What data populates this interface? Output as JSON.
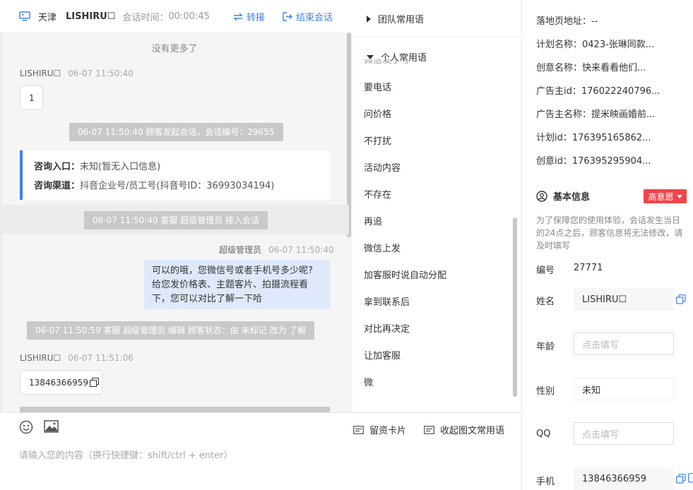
{
  "header": {
    "city": "天津",
    "username": "LISHIRU☐",
    "session_time_label": "会话时间：",
    "session_time": "00:00:45",
    "transfer_label": "转接",
    "end_label": "结束会话"
  },
  "chat": {
    "no_more": "没有更多了",
    "msg1": {
      "sender": "LISHIRU☐",
      "time": "06-07 11:50:40",
      "text": "1"
    },
    "sys1": "06-07 11:50:40 顾客发起会话，会话编号：29655",
    "consult": {
      "entry_label": "咨询入口：",
      "entry_value": "未知(暂无入口信息)",
      "channel_label": "咨询渠道：",
      "channel_value": "抖音企业号/员工号(抖音号ID：36993034194)"
    },
    "sys2": "06-07 11:50:40 客服 超级管理员 接入会话",
    "msg2": {
      "sender": "超级管理员",
      "time": "06-07 11:50:40",
      "lines": [
        "可以的哦，您微信号或者手机号多少呢?",
        "给您发价格表、主题客片、拍摄流程看",
        "下，您可以对比了解一下哈"
      ]
    },
    "sys3": "06-07 11:50:59 客服 超级管理员 编辑 顾客状态：由 未标记 改为 了解",
    "msg3": {
      "sender": "LISHIRU☐",
      "time": "06-07 11:51:06",
      "text": "13846366959"
    }
  },
  "phrases": {
    "team_group": "团队常用语",
    "personal_group": "个人常用语",
    "cut_item": "微信发了号",
    "items": [
      "要电话",
      "问价格",
      "不打扰",
      "活动内容",
      "不存在",
      "再追",
      "微信上发",
      "加客服时说自动分配",
      "拿到联系后",
      "对比再决定",
      "让加客服",
      "微"
    ]
  },
  "input": {
    "card_label": "留资卡片",
    "collapse_label": "收起图文常用语",
    "placeholder": "请输入您的内容（换行快捷键：shift/ctrl + enter）"
  },
  "info": {
    "landing_label": "落地页地址：",
    "landing_value": "--",
    "plan_name_label": "计划名称：",
    "plan_name_value": "0423-张琳同款...",
    "creative_name_label": "创意名称：",
    "creative_name_value": "快来看看他们...",
    "advertiser_id_label": "广告主id：",
    "advertiser_id_value": "176022240796...",
    "advertiser_name_label": "广告主名称：",
    "advertiser_name_value": "提米映画婚前...",
    "plan_id_label": "计划id：",
    "plan_id_value": "176395165862...",
    "creative_id_label": "创意id：",
    "creative_id_value": "176395295904...",
    "basic_title": "基本信息",
    "intent_tag": "高意愿",
    "notice": "为了保障您的使用体验，会话发生当日的24点之后，顾客信息将无法修改，请及时填写",
    "id_label": "编号",
    "id_value": "27771",
    "name_label": "姓名",
    "name_value": "LISHIRU☐",
    "age_label": "年龄",
    "age_placeholder": "点击填写",
    "gender_label": "性别",
    "gender_value": "未知",
    "qq_label": "QQ",
    "qq_placeholder": "点击填写",
    "phone_label": "手机",
    "phone_value": "13846366959"
  },
  "colors": {
    "accent": "#3a7ff6",
    "tag_red": "#f0454a",
    "system_grey": "#c9c9c9",
    "out_bubble": "#dfe9fb"
  }
}
